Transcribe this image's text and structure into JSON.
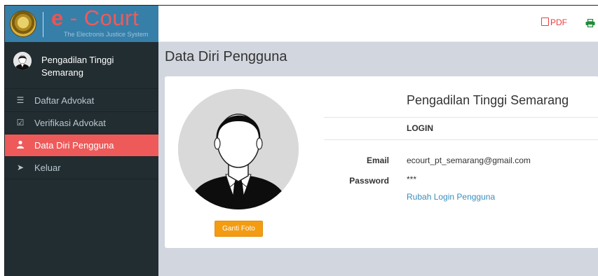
{
  "app": {
    "brand_e": "e",
    "brand_rest": " - Court",
    "subtitle": "The Electronis Justice System"
  },
  "user": {
    "name": "Pengadilan Tinggi Semarang"
  },
  "menu": [
    {
      "label": "Daftar Advokat",
      "icon": "list-icon",
      "active": false
    },
    {
      "label": "Verifikasi Advokat",
      "icon": "check-square-icon",
      "active": false
    },
    {
      "label": "Data Diri Pengguna",
      "icon": "user-icon",
      "active": true
    },
    {
      "label": "Keluar",
      "icon": "sign-out-icon",
      "active": false
    }
  ],
  "topbar": {
    "pdf_label": "PDF",
    "print_icon": "print-icon"
  },
  "page": {
    "title": "Data Diri Pengguna"
  },
  "profile": {
    "court_name": "Pengadilan Tinggi Semarang",
    "section_heading": "LOGIN",
    "email_label": "Email",
    "email_value": "ecourt_pt_semarang@gmail.com",
    "password_label": "Password",
    "password_value": "***",
    "change_login_link": "Rubah Login Pengguna",
    "change_photo_button": "Ganti Foto"
  },
  "colors": {
    "sidebar_bg": "#222d32",
    "header_bg": "#367fa9",
    "active_item": "#ee5a5a",
    "button_orange": "#f39c12",
    "link_blue": "#3c8dbc"
  }
}
